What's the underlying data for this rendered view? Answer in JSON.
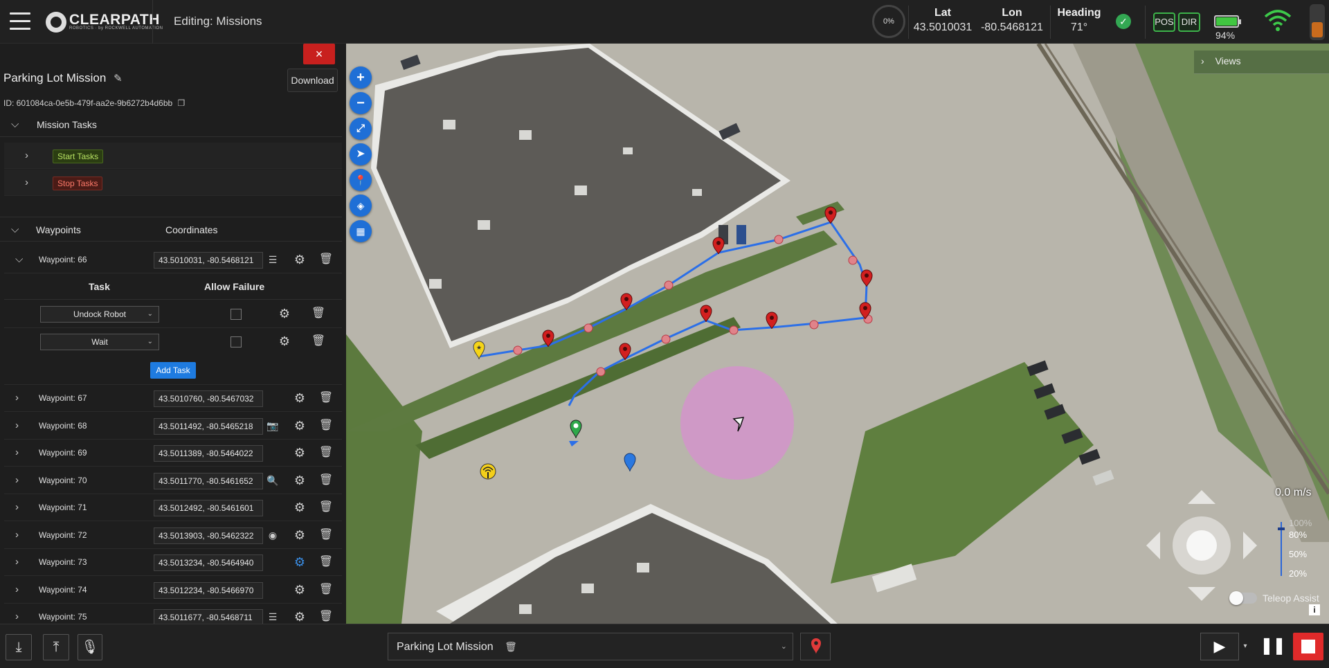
{
  "topbar": {
    "logo_text": "CLEARPATH",
    "logo_sub": "ROBOTICS · by ROCKWELL AUTOMATION",
    "editing_title": "Editing: Missions",
    "progress": "0%",
    "lat_label": "Lat",
    "lat_value": "43.5010031",
    "lon_label": "Lon",
    "lon_value": "-80.5468121",
    "heading_label": "Heading",
    "heading_value": "71°",
    "pos_label": "POS",
    "dir_label": "DIR",
    "battery_pct": "94%"
  },
  "panel": {
    "close_label": "×",
    "mission_name": "Parking Lot Mission",
    "download_label": "Download",
    "mission_id": "ID: 601084ca-0e5b-479f-aa2e-9b6272b4d6bb",
    "mission_tasks_label": "Mission Tasks",
    "start_tasks_label": "Start Tasks",
    "stop_tasks_label": "Stop Tasks",
    "waypoints_label": "Waypoints",
    "coordinates_label": "Coordinates",
    "task_col": "Task",
    "allow_failure_col": "Allow Failure",
    "add_task_label": "Add Task",
    "expanded": {
      "name": "Waypoint: 66",
      "coords": "43.5010031, -80.5468121",
      "icon": "tasks-icon",
      "tasks": [
        {
          "name": "Undock Robot"
        },
        {
          "name": "Wait"
        }
      ]
    },
    "waypoints": [
      {
        "name": "Waypoint: 67",
        "coords": "43.5010760, -80.5467032",
        "icon": ""
      },
      {
        "name": "Waypoint: 68",
        "coords": "43.5011492, -80.5465218",
        "icon": "camera-icon"
      },
      {
        "name": "Waypoint: 69",
        "coords": "43.5011389, -80.5464022",
        "icon": ""
      },
      {
        "name": "Waypoint: 70",
        "coords": "43.5011770, -80.5461652",
        "icon": "inspect-icon"
      },
      {
        "name": "Waypoint: 71",
        "coords": "43.5012492, -80.5461601",
        "icon": ""
      },
      {
        "name": "Waypoint: 72",
        "coords": "43.5013903, -80.5462322",
        "icon": "ptz-icon"
      },
      {
        "name": "Waypoint: 73",
        "coords": "43.5013234, -80.5464940",
        "icon": "gear-blue"
      },
      {
        "name": "Waypoint: 74",
        "coords": "43.5012234, -80.5466970",
        "icon": ""
      },
      {
        "name": "Waypoint: 75",
        "coords": "43.5011677, -80.5468711",
        "icon": "tasks-icon"
      }
    ]
  },
  "map": {
    "views_label": "Views",
    "speed": "0.0 m/s",
    "scale": [
      "100%",
      "80%",
      "50%",
      "20%"
    ],
    "teleop_label": "Teleop Assist",
    "info_label": "i"
  },
  "bottombar": {
    "mission_select": "Parking Lot Mission"
  },
  "colors": {
    "accent": "#1f6fd6",
    "route": "#2b6fe8",
    "marker": "#d21f1f",
    "stop": "#e02a2a",
    "ok": "#3db34a"
  }
}
